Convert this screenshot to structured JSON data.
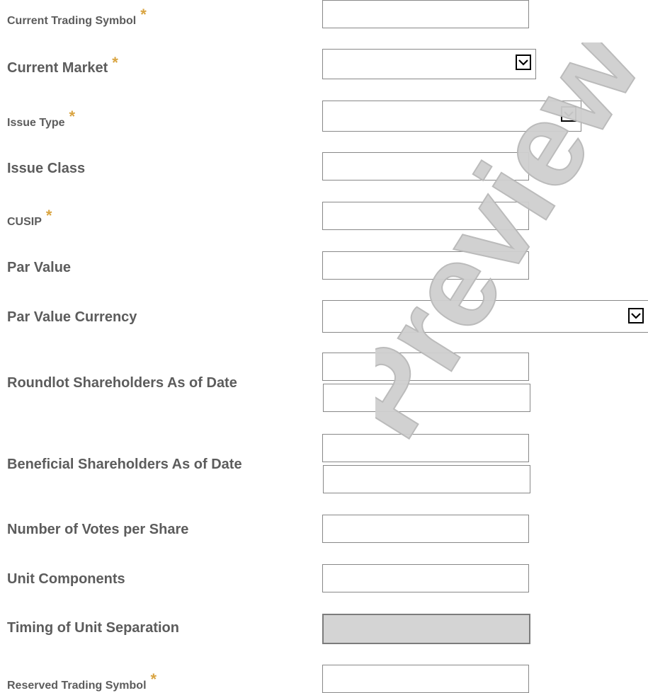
{
  "fields": [
    {
      "key": "current_trading_symbol",
      "label": "Current Trading Symbol",
      "required": true,
      "value": ""
    },
    {
      "key": "current_market",
      "label": "Current Market",
      "required": true,
      "value": ""
    },
    {
      "key": "issue_type",
      "label": "Issue Type",
      "required": true,
      "value": ""
    },
    {
      "key": "issue_class",
      "label": "Issue Class",
      "required": false,
      "value": ""
    },
    {
      "key": "cusip",
      "label": "CUSIP",
      "required": true,
      "value": ""
    },
    {
      "key": "par_value",
      "label": "Par Value",
      "required": false,
      "value": ""
    },
    {
      "key": "par_value_currency",
      "label": "Par Value Currency",
      "required": false,
      "value": ""
    },
    {
      "key": "roundlot_shareholders",
      "label": "Roundlot Shareholders As of Date",
      "required": false,
      "value": "",
      "date": ""
    },
    {
      "key": "beneficial_shareholders",
      "label": "Beneficial Shareholders As of Date",
      "required": false,
      "value": "",
      "date": ""
    },
    {
      "key": "votes_per_share",
      "label": "Number of Votes per Share",
      "required": false,
      "value": ""
    },
    {
      "key": "unit_components",
      "label": "Unit Components",
      "required": false,
      "value": ""
    },
    {
      "key": "timing_unit_separation",
      "label": "Timing of Unit Separation",
      "required": false,
      "value": "",
      "disabled": true
    },
    {
      "key": "reserved_trading_symbol",
      "label": "Reserved Trading Symbol",
      "required": true,
      "value": ""
    }
  ],
  "required_marker": "*",
  "watermark": {
    "text": "Preview",
    "color": "#cfcfcf"
  },
  "colors": {
    "label": "#5c5c5c",
    "required": "#d9a441",
    "disabled_bg": "#d4d4d4"
  }
}
